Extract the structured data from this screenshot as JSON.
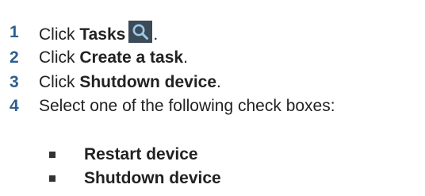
{
  "steps": [
    {
      "number": "1",
      "prefix": "Click ",
      "bold": "Tasks",
      "suffix": ".",
      "icon": "search-icon"
    },
    {
      "number": "2",
      "prefix": "Click ",
      "bold": "Create a task",
      "suffix": "."
    },
    {
      "number": "3",
      "prefix": "Click ",
      "bold": "Shutdown device",
      "suffix": "."
    },
    {
      "number": "4",
      "text": "Select one of the following check boxes:"
    }
  ],
  "options": [
    {
      "label": "Restart device"
    },
    {
      "label": "Shutdown device"
    }
  ],
  "colors": {
    "step_number": "#2e5e8e",
    "icon_background": "#3b4b57",
    "icon_glyph": "#9ec8e8",
    "text": "#222222"
  }
}
